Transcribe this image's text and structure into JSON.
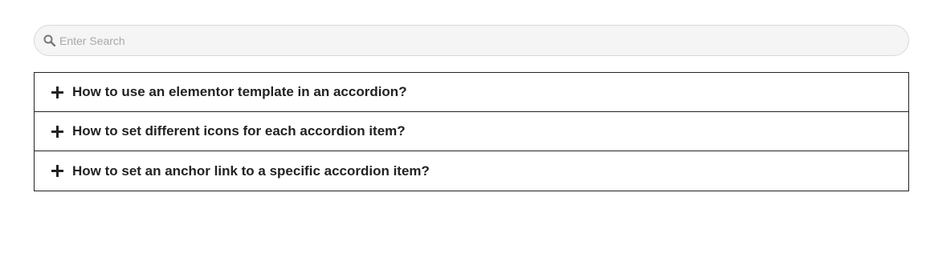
{
  "search": {
    "placeholder": "Enter Search",
    "icon": "search-icon"
  },
  "accordion": {
    "items": [
      {
        "title": "How to use an elementor template in an accordion?",
        "icon": "plus-icon"
      },
      {
        "title": "How to set different icons for each accordion item?",
        "icon": "plus-icon"
      },
      {
        "title": "How to set an anchor link to a specific accordion item?",
        "icon": "plus-icon"
      }
    ]
  },
  "colors": {
    "border": "#222222",
    "search_bg": "#f5f5f5",
    "text": "#222222"
  }
}
